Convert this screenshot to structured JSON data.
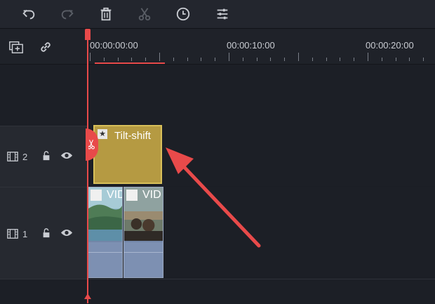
{
  "toolbar": {
    "buttons": [
      {
        "name": "undo-button",
        "icon": "undo-icon",
        "enabled": true
      },
      {
        "name": "redo-button",
        "icon": "redo-icon",
        "enabled": false
      },
      {
        "name": "delete-button",
        "icon": "trash-icon",
        "enabled": true
      },
      {
        "name": "cut-button",
        "icon": "scissors-icon",
        "enabled": false
      },
      {
        "name": "duration-button",
        "icon": "clock-icon",
        "enabled": true
      },
      {
        "name": "adjust-button",
        "icon": "sliders-icon",
        "enabled": true
      }
    ]
  },
  "header_controls": {
    "add_track_icon": "add-track-icon",
    "link_icon": "link-icon"
  },
  "ruler": {
    "timecodes": [
      "00:00:00:00",
      "00:00:10:00",
      "00:00:20:00"
    ]
  },
  "tracks": [
    {
      "number": "2",
      "type": "effect",
      "lock_icon": "unlock-icon",
      "visibility_icon": "eye-icon"
    },
    {
      "number": "1",
      "type": "video",
      "lock_icon": "unlock-icon",
      "visibility_icon": "eye-icon"
    }
  ],
  "effect_clip": {
    "label": "Tilt-shift",
    "icon": "effect-star-icon"
  },
  "video_clips": [
    {
      "label": "VID",
      "icon": "film-icon"
    },
    {
      "label": "VID",
      "icon": "film-icon"
    }
  ],
  "colors": {
    "accent": "#e84a4a",
    "effect_clip": "#b59a42",
    "video_clip": "#7286a8",
    "background": "#1a1d24"
  }
}
